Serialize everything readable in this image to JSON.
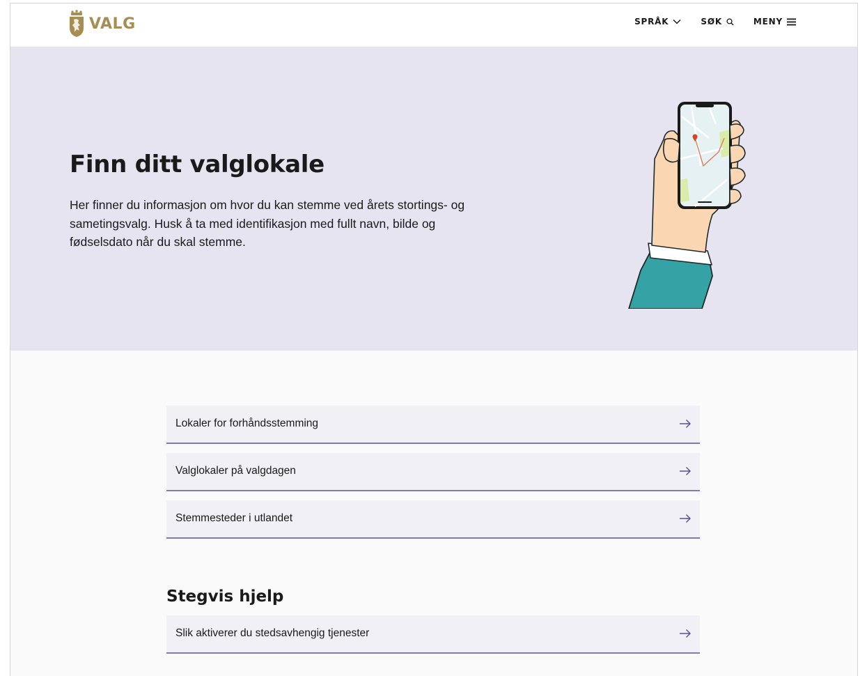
{
  "header": {
    "logo_text": "VALG",
    "nav": {
      "language_label": "SPRÅK",
      "search_label": "SØK",
      "menu_label": "MENY"
    }
  },
  "hero": {
    "title": "Finn ditt valglokale",
    "text": "Her finner du informasjon om hvor du kan stemme ved årets stortings- og sametingsvalg. Husk å ta med identifikasjon med fullt navn, bilde og fødselsdato når du skal stemme."
  },
  "links": [
    {
      "label": "Lokaler for forhåndsstemming"
    },
    {
      "label": "Valglokaler på valgdagen"
    },
    {
      "label": "Stemmesteder i utlandet"
    }
  ],
  "help": {
    "title": "Stegvis hjelp",
    "links": [
      {
        "label": "Slik aktiverer du stedsavhengig tjenester"
      }
    ]
  },
  "colors": {
    "brand_gold": "#a88d52",
    "hero_background": "#e6e4f0",
    "link_background": "#f1f0f6",
    "accent_purple": "#8478b9"
  },
  "icons": {
    "logo": "coat-of-arms-lion",
    "language": "chevron-down-icon",
    "search": "magnifier-icon",
    "menu": "hamburger-icon",
    "link": "arrow-right-icon"
  }
}
